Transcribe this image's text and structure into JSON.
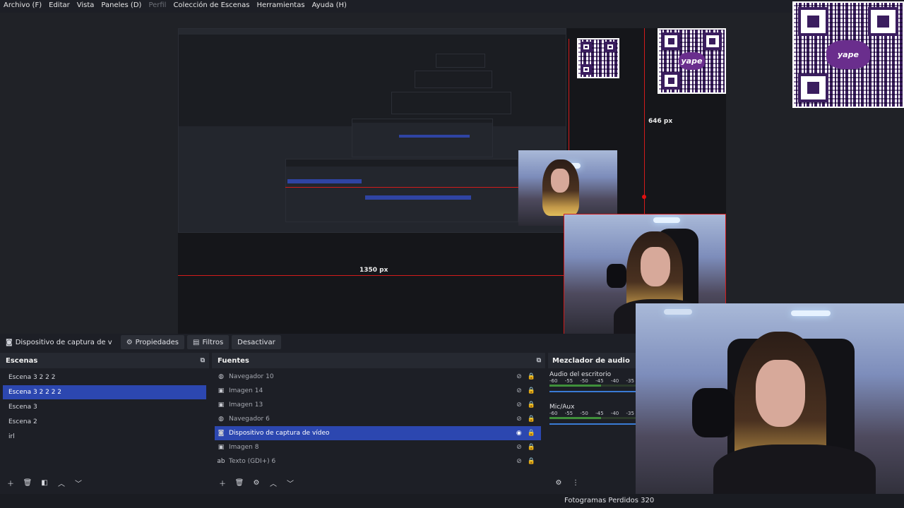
{
  "menu": [
    {
      "label": "Archivo (F)",
      "enabled": true
    },
    {
      "label": "Editar",
      "enabled": true
    },
    {
      "label": "Vista",
      "enabled": true
    },
    {
      "label": "Paneles (D)",
      "enabled": true
    },
    {
      "label": "Perfil",
      "enabled": false
    },
    {
      "label": "Colección de Escenas",
      "enabled": true
    },
    {
      "label": "Herramientas",
      "enabled": true
    },
    {
      "label": "Ayuda (H)",
      "enabled": true
    }
  ],
  "preview": {
    "dimension_width_label": "1350 px",
    "dimension_height_label": "646 px",
    "qr_logo_text": "yape"
  },
  "source_toolbar": {
    "selected_source": "Dispositivo de captura de v",
    "properties_label": "Propiedades",
    "filters_label": "Filtros",
    "deactivate_label": "Desactivar"
  },
  "scenes": {
    "title": "Escenas",
    "items": [
      {
        "label": "Escena 3 2 2 2",
        "selected": false
      },
      {
        "label": "Escena 3 2 2 2 2",
        "selected": true
      },
      {
        "label": "Escena 3",
        "selected": false
      },
      {
        "label": "Escena 2",
        "selected": false
      },
      {
        "label": "irl",
        "selected": false
      }
    ]
  },
  "sources": {
    "title": "Fuentes",
    "items": [
      {
        "label": "Navegador 10",
        "icon": "globe-icon",
        "selected": false
      },
      {
        "label": "Imagen 14",
        "icon": "image-icon",
        "selected": false
      },
      {
        "label": "Imagen 13",
        "icon": "image-icon",
        "selected": false
      },
      {
        "label": "Navegador 6",
        "icon": "globe-icon",
        "selected": false
      },
      {
        "label": "Dispositivo de captura de vídeo",
        "icon": "camera-icon",
        "selected": true
      },
      {
        "label": "Imagen 8",
        "icon": "image-icon",
        "selected": false
      },
      {
        "label": "Texto (GDI+) 6",
        "icon": "text-icon",
        "selected": false
      }
    ]
  },
  "mixer": {
    "title": "Mezclador de audio",
    "tracks": [
      {
        "name": "Audio del escritorio",
        "scale": [
          "-60",
          "-55",
          "-50",
          "-45",
          "-40",
          "-35"
        ]
      },
      {
        "name": "Mic/Aux",
        "scale": [
          "-60",
          "-55",
          "-50",
          "-45",
          "-40",
          "-35"
        ]
      }
    ]
  },
  "status": {
    "text": "Fotogramas Perdidos 320"
  }
}
